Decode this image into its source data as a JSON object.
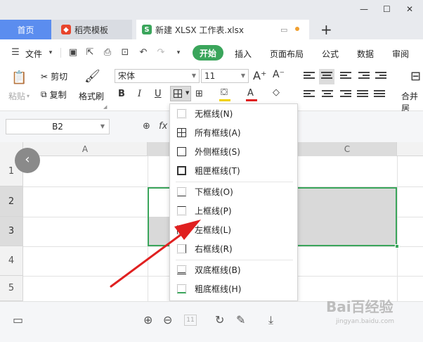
{
  "tabs": {
    "home": "首页",
    "template": "稻壳模板",
    "file": "新建 XLSX 工作表.xlsx"
  },
  "window_controls": [
    "—",
    "☐",
    "✕"
  ],
  "menu": {
    "file": "文件",
    "items": [
      "开始",
      "插入",
      "页面布局",
      "公式",
      "数据",
      "审阅"
    ]
  },
  "ribbon": {
    "paste": "粘贴",
    "cut": "剪切",
    "copy": "复制",
    "format_painter": "格式刷",
    "font_name": "宋体",
    "font_size": "11",
    "bold": "B",
    "italic": "I",
    "underline": "U",
    "font_color_glyph": "A",
    "merge_center": "合并居"
  },
  "formula_bar": {
    "name_box": "B2",
    "fx": "fx"
  },
  "grid": {
    "columns": [
      "A",
      "C"
    ],
    "rows": [
      "1",
      "2",
      "3",
      "4",
      "5"
    ],
    "selected_rows": [
      "2",
      "3"
    ]
  },
  "border_menu": {
    "items": [
      {
        "label": "无框线(N)",
        "icon": "no-border"
      },
      {
        "label": "所有框线(A)",
        "icon": "all-borders"
      },
      {
        "label": "外侧框线(S)",
        "icon": "outside-borders"
      },
      {
        "label": "粗匣框线(T)",
        "icon": "thick-box-border"
      },
      {
        "label": "下框线(O)",
        "icon": "bottom-border"
      },
      {
        "label": "上框线(P)",
        "icon": "top-border"
      },
      {
        "label": "左框线(L)",
        "icon": "left-border"
      },
      {
        "label": "右框线(R)",
        "icon": "right-border"
      },
      {
        "label": "双底框线(B)",
        "icon": "double-bottom-border"
      },
      {
        "label": "粗底框线(H)",
        "icon": "thick-bottom-border"
      }
    ]
  },
  "bottom_bar": {
    "page_box": "11"
  },
  "watermark": {
    "main": "Bai百经验",
    "sub": "jingyan.baidu.com"
  },
  "colors": {
    "accent_green": "#3aa55b",
    "home_tab_blue": "#5b8def",
    "arrow_red": "#e02020"
  }
}
